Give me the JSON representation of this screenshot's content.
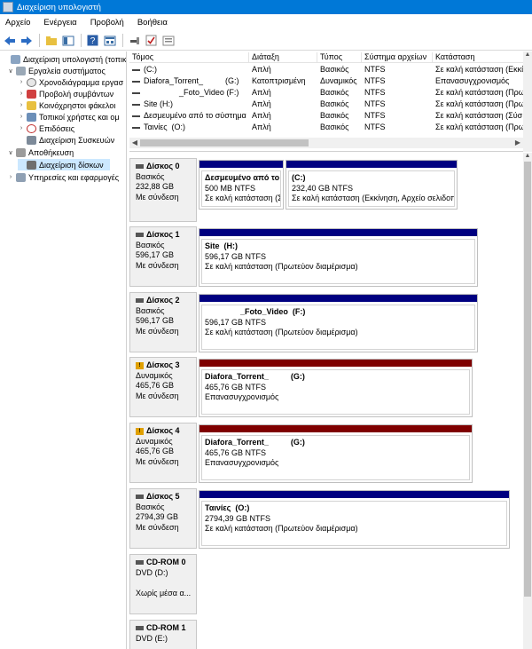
{
  "window": {
    "title": "Διαχείριση υπολογιστή"
  },
  "menu": [
    "Αρχείο",
    "Ενέργεια",
    "Προβολή",
    "Βοήθεια"
  ],
  "toolbar": {
    "icons": [
      "back-arrow-icon",
      "forward-arrow-icon",
      "up-folder-icon",
      "show-hide-tree-icon",
      "help-icon",
      "properties-icon",
      "connect-icon",
      "check-icon",
      "settings-icon"
    ]
  },
  "tree": {
    "items": [
      {
        "label": "Διαχείριση υπολογιστή (τοπικ",
        "icon": "computer-icon",
        "level": 0,
        "expander": ""
      },
      {
        "label": "Εργαλεία συστήματος",
        "icon": "tools-icon",
        "level": 1,
        "expander": "v"
      },
      {
        "label": "Χρονοδιάγραμμα εργασ",
        "icon": "clock-icon",
        "level": 2,
        "expander": ">"
      },
      {
        "label": "Προβολή συμβάντων",
        "icon": "event-viewer-icon",
        "level": 2,
        "expander": ">"
      },
      {
        "label": "Κοινόχρηστοι φάκελοι",
        "icon": "shared-folder-icon",
        "level": 2,
        "expander": ">"
      },
      {
        "label": "Τοπικοί χρήστες και ομ",
        "icon": "users-icon",
        "level": 2,
        "expander": ">"
      },
      {
        "label": "Επιδόσεις",
        "icon": "performance-icon",
        "level": 2,
        "expander": ">"
      },
      {
        "label": "Διαχείριση Συσκευών",
        "icon": "device-manager-icon",
        "level": 2,
        "expander": ""
      },
      {
        "label": "Αποθήκευση",
        "icon": "storage-icon",
        "level": 1,
        "expander": "v"
      },
      {
        "label": "Διαχείριση δίσκων",
        "icon": "disk-management-icon",
        "level": 2,
        "expander": "",
        "selected": true
      },
      {
        "label": "Υπηρεσίες και εφαρμογές",
        "icon": "services-icon",
        "level": 1,
        "expander": ">"
      }
    ]
  },
  "volumes": {
    "headers": [
      "Τόμος",
      "Διάταξη",
      "Τύπος",
      "Σύστημα αρχείων",
      "Κατάσταση"
    ],
    "rows": [
      [
        "(C:)",
        "Απλή",
        "Βασικός",
        "NTFS",
        "Σε καλή κατάσταση (Εκκί"
      ],
      [
        "Diafora_Torrent_          (G:)",
        "Κατοπτρισμένη",
        "Δυναμικός",
        "NTFS",
        "Επανασυγχρονισμός"
      ],
      [
        "                _Foto_Video (F:)",
        "Απλή",
        "Βασικός",
        "NTFS",
        "Σε καλή κατάσταση (Πρω"
      ],
      [
        "Site (H:)",
        "Απλή",
        "Βασικός",
        "NTFS",
        "Σε καλή κατάσταση (Πρω"
      ],
      [
        "Δεσμευμένο από το σύστημα",
        "Απλή",
        "Βασικός",
        "NTFS",
        "Σε καλή κατάσταση (Σύσ"
      ],
      [
        "Ταινίες  (O:)",
        "Απλή",
        "Βασικός",
        "NTFS",
        "Σε καλή κατάσταση (Πρω"
      ]
    ]
  },
  "disks": [
    {
      "name": "Δίσκος 0",
      "type": "Βασικός",
      "size": "232,88 GB",
      "status": "Με σύνδεση",
      "warning": false,
      "partitions": [
        {
          "name": "Δεσμευμένο από το",
          "size": "500 MB NTFS",
          "status": "Σε καλή κατάσταση (Σ",
          "color": "blue"
        },
        {
          "name": "(C:)",
          "size": "232,40 GB NTFS",
          "status": "Σε καλή κατάσταση (Εκκίνηση, Αρχείο σελιδοπ",
          "color": "blue"
        }
      ]
    },
    {
      "name": "Δίσκος 1",
      "type": "Βασικός",
      "size": "596,17 GB",
      "status": "Με σύνδεση",
      "warning": false,
      "partitions": [
        {
          "name": "Site  (H:)",
          "size": "596,17 GB NTFS",
          "status": "Σε καλή κατάσταση (Πρωτεύον διαμέρισμα)",
          "color": "blue"
        }
      ]
    },
    {
      "name": "Δίσκος 2",
      "type": "Βασικός",
      "size": "596,17 GB",
      "status": "Με σύνδεση",
      "warning": false,
      "partitions": [
        {
          "name": "                _Foto_Video  (F:)",
          "size": "596,17 GB NTFS",
          "status": "Σε καλή κατάσταση (Πρωτεύον διαμέρισμα)",
          "color": "blue"
        }
      ]
    },
    {
      "name": "Δίσκος 3",
      "type": "Δυναμικός",
      "size": "465,76 GB",
      "status": "Με σύνδεση",
      "warning": true,
      "partitions": [
        {
          "name": "Diafora_Torrent_          (G:)",
          "size": "465,76 GB NTFS",
          "status": "Επανασυγχρονισμός",
          "color": "red"
        }
      ]
    },
    {
      "name": "Δίσκος 4",
      "type": "Δυναμικός",
      "size": "465,76 GB",
      "status": "Με σύνδεση",
      "warning": true,
      "partitions": [
        {
          "name": "Diafora_Torrent_          (G:)",
          "size": "465,76 GB NTFS",
          "status": "Επανασυγχρονισμός",
          "color": "red"
        }
      ]
    },
    {
      "name": "Δίσκος 5",
      "type": "Βασικός",
      "size": "2794,39 GB",
      "status": "Με σύνδεση",
      "warning": false,
      "partitions": [
        {
          "name": "Ταινίες  (O:)",
          "size": "2794,39 GB NTFS",
          "status": "Σε καλή κατάσταση (Πρωτεύον διαμέρισμα)",
          "color": "blue"
        }
      ]
    }
  ],
  "cdroms": [
    {
      "name": "CD-ROM 0",
      "type": "DVD (D:)",
      "status": "Χωρίς μέσα α..."
    },
    {
      "name": "CD-ROM 1",
      "type": "DVD (E:)",
      "status": ""
    }
  ]
}
